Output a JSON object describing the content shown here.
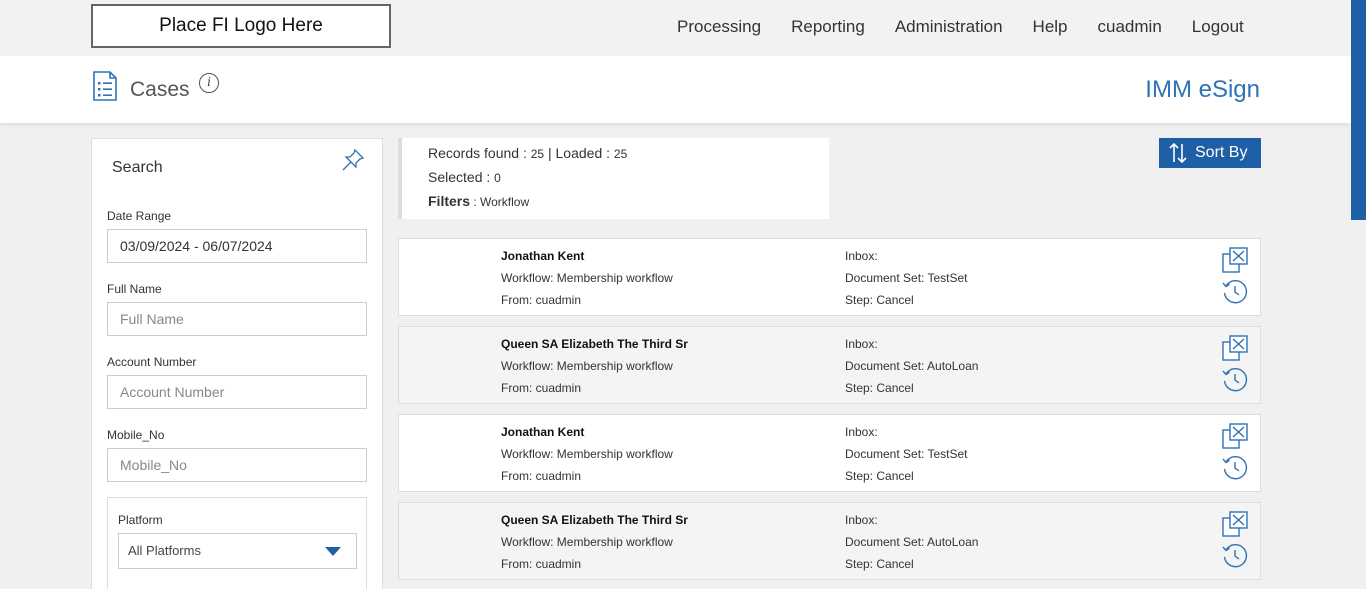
{
  "topnav": {
    "logo_text": "Place FI Logo Here",
    "links": [
      "Processing",
      "Reporting",
      "Administration",
      "Help",
      "cuadmin",
      "Logout"
    ]
  },
  "header": {
    "title": "Cases",
    "brand": "IMM eSign"
  },
  "colors": {
    "accent": "#1e5fa6",
    "brand_text": "#2f73b6"
  },
  "search": {
    "title": "Search",
    "date_range_label": "Date Range",
    "date_range_value": "03/09/2024 - 06/07/2024",
    "full_name_label": "Full Name",
    "full_name_placeholder": "Full Name",
    "account_label": "Account Number",
    "account_placeholder": "Account Number",
    "mobile_label": "Mobile_No",
    "mobile_placeholder": "Mobile_No",
    "platform_label": "Platform",
    "platform_value": "All Platforms"
  },
  "summary": {
    "records_found_label": "Records found : ",
    "records_found": "25",
    "loaded_label": " | Loaded : ",
    "loaded": "25",
    "selected_label": "Selected : ",
    "selected": "0",
    "filters_label": "Filters",
    "filters_value": " : Workflow"
  },
  "sort_button": "Sort By",
  "cases": [
    {
      "name": "Jonathan Kent",
      "workflow": "Workflow: Membership workflow",
      "from": "From: cuadmin",
      "inbox": "Inbox:",
      "docset": "Document Set: TestSet",
      "step": "Step: Cancel"
    },
    {
      "name": "Queen SA Elizabeth The Third Sr",
      "workflow": "Workflow: Membership workflow",
      "from": "From: cuadmin",
      "inbox": "Inbox:",
      "docset": "Document Set: AutoLoan",
      "step": "Step: Cancel"
    },
    {
      "name": "Jonathan Kent",
      "workflow": "Workflow: Membership workflow",
      "from": "From: cuadmin",
      "inbox": "Inbox:",
      "docset": "Document Set: TestSet",
      "step": "Step: Cancel"
    },
    {
      "name": "Queen SA Elizabeth The Third Sr",
      "workflow": "Workflow: Membership workflow",
      "from": "From: cuadmin",
      "inbox": "Inbox:",
      "docset": "Document Set: AutoLoan",
      "step": "Step: Cancel"
    }
  ]
}
